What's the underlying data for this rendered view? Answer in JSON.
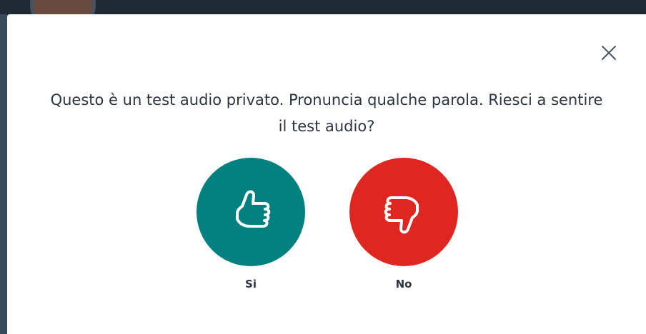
{
  "modal": {
    "prompt_line1": "Questo è un test audio privato. Pronuncia qualche parola. Riesci a sentire",
    "prompt_line2": "il test audio?",
    "close_icon": "close-icon",
    "yes": {
      "label": "Si",
      "icon": "thumbs-up-icon",
      "color": "#00807f"
    },
    "no": {
      "label": "No",
      "icon": "thumbs-down-icon",
      "color": "#df2721"
    }
  }
}
